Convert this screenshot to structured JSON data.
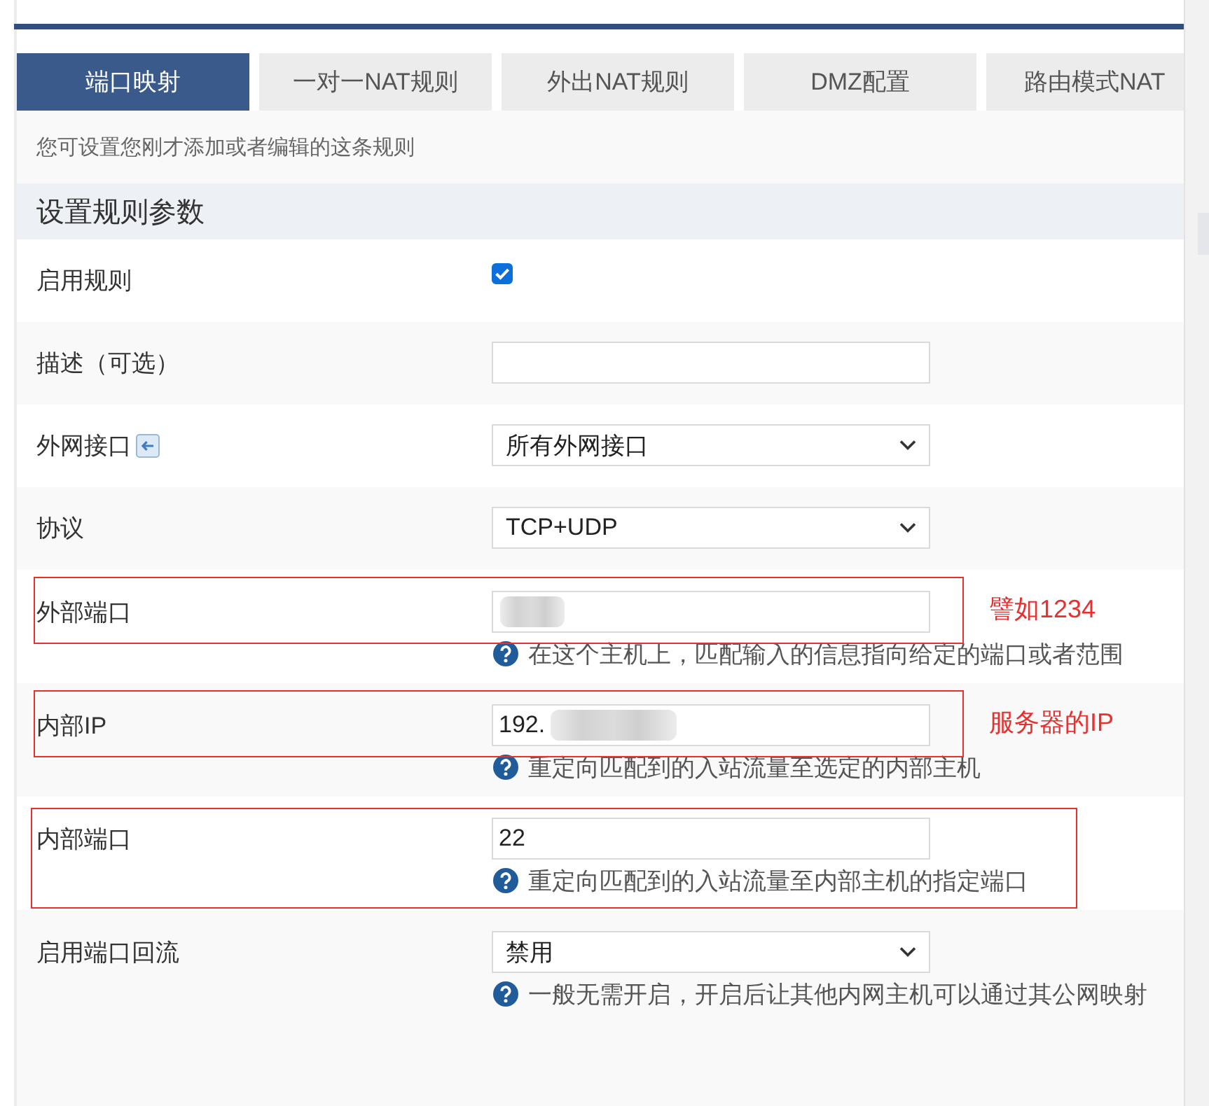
{
  "tabs": [
    {
      "label": "端口映射",
      "selected": true
    },
    {
      "label": "一对一NAT规则",
      "selected": false
    },
    {
      "label": "外出NAT规则",
      "selected": false
    },
    {
      "label": "DMZ配置",
      "selected": false
    },
    {
      "label": "路由模式NAT",
      "selected": false
    }
  ],
  "intro": "您可设置您刚才添加或者编辑的这条规则",
  "section_title": "设置规则参数",
  "fields": [
    {
      "kind": "checkbox",
      "label": "启用规则",
      "checked": true
    },
    {
      "kind": "text",
      "label": "描述（可选）"
    },
    {
      "kind": "select",
      "label": "外网接口",
      "label_icon": true,
      "value": "所有外网接口"
    },
    {
      "kind": "select",
      "label": "协议",
      "value": "TCP+UDP"
    },
    {
      "kind": "text",
      "label": "外部端口",
      "redacted": true,
      "help": "在这个主机上，匹配输入的信息指向给定的端口或者范围",
      "annotation": {
        "kind": "field",
        "note": "譬如1234"
      }
    },
    {
      "kind": "text",
      "label": "内部IP",
      "value": "192.",
      "redacted": true,
      "help": "重定向匹配到的入站流量至选定的内部主机",
      "annotation": {
        "kind": "field",
        "note": "服务器的IP"
      }
    },
    {
      "kind": "text",
      "label": "内部端口",
      "value": "22",
      "help": "重定向匹配到的入站流量至内部主机的指定端口",
      "annotation": {
        "kind": "block"
      }
    },
    {
      "kind": "select",
      "label": "启用端口回流",
      "value": "禁用",
      "help": "一般无需开启，开启后让其他内网主机可以通过其公网映射"
    }
  ]
}
